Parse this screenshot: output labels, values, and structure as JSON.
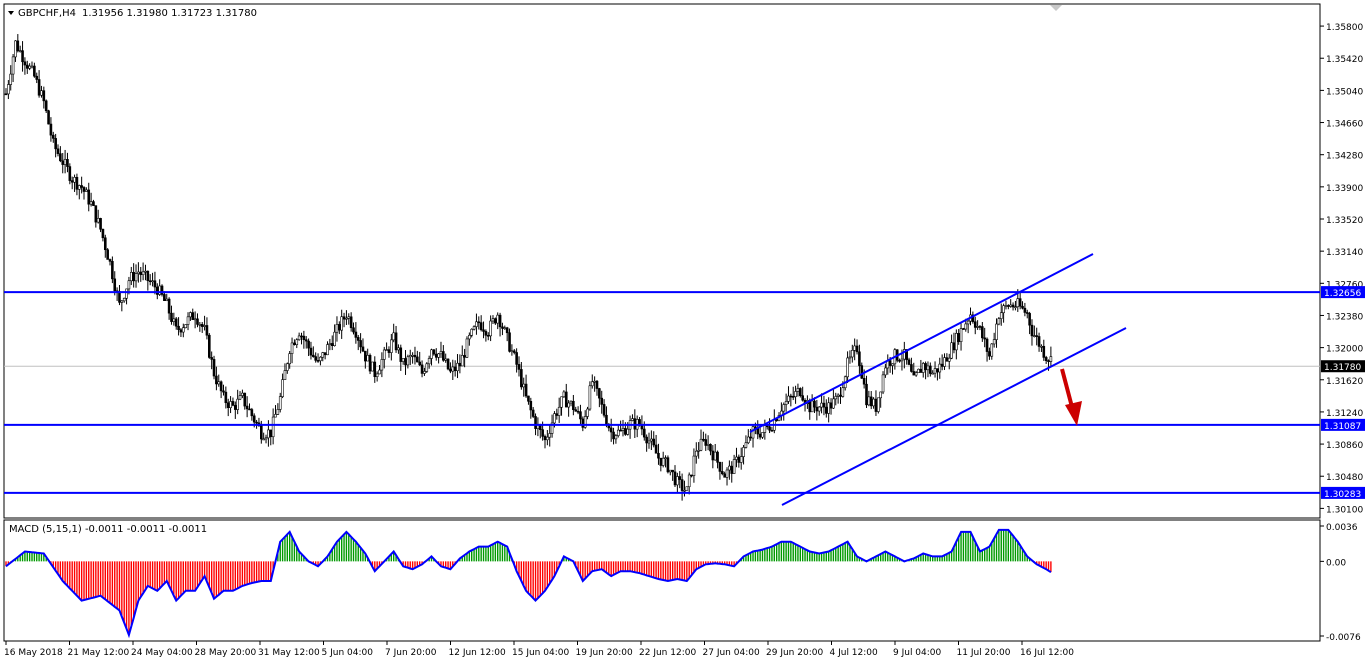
{
  "header": {
    "symbol": "GBPCHF,H4",
    "ohlc": "1.31956 1.31980 1.31723 1.31780",
    "menu_icon": "triangle-down-icon"
  },
  "macd_header": "MACD (5,15,1) -0.0011 -0.0011 -0.0011",
  "colors": {
    "candle": "#000000",
    "level_line": "#0000ff",
    "channel_line": "#0000ff",
    "arrow": "#cc0000",
    "macd_pos": "#009900",
    "macd_neg": "#ff0000",
    "macd_signal": "#0000ff",
    "price_line": "#c0c0c0",
    "label_bg": "#0000ff"
  },
  "chart_data": {
    "type": "candlestick",
    "price_axis": {
      "range": [
        1.3001,
        1.3599
      ],
      "ticks": [
        "1.35800",
        "1.35420",
        "1.35040",
        "1.34660",
        "1.34280",
        "1.33900",
        "1.33520",
        "1.33140",
        "1.32760",
        "1.32380",
        "1.32000",
        "1.31620",
        "1.31240",
        "1.30860",
        "1.30480",
        "1.30100"
      ]
    },
    "horizontal_levels": [
      {
        "value": 1.32656,
        "label": "1.32656"
      },
      {
        "value": 1.31087,
        "label": "1.31087"
      },
      {
        "value": 1.30283,
        "label": "1.30283"
      }
    ],
    "current_price": {
      "value": 1.3178,
      "label": "1.31780"
    },
    "time_labels": [
      "16 May 2018",
      "21 May 12:00",
      "24 May 04:00",
      "28 May 20:00",
      "31 May 12:00",
      "5 Jun 04:00",
      "7 Jun 20:00",
      "12 Jun 12:00",
      "15 Jun 04:00",
      "19 Jun 20:00",
      "22 Jun 12:00",
      "27 Jun 04:00",
      "29 Jun 20:00",
      "4 Jul 12:00",
      "9 Jul 04:00",
      "11 Jul 20:00",
      "16 Jul 12:00"
    ],
    "close_path": [
      [
        0,
        1.35
      ],
      [
        4,
        1.356
      ],
      [
        8,
        1.354
      ],
      [
        12,
        1.352
      ],
      [
        16,
        1.349
      ],
      [
        20,
        1.344
      ],
      [
        24,
        1.342
      ],
      [
        28,
        1.34
      ],
      [
        32,
        1.339
      ],
      [
        36,
        1.337
      ],
      [
        40,
        1.334
      ],
      [
        44,
        1.33
      ],
      [
        48,
        1.325
      ],
      [
        52,
        1.328
      ],
      [
        56,
        1.329
      ],
      [
        60,
        1.328
      ],
      [
        64,
        1.327
      ],
      [
        68,
        1.325
      ],
      [
        72,
        1.322
      ],
      [
        76,
        1.323
      ],
      [
        80,
        1.324
      ],
      [
        84,
        1.322
      ],
      [
        88,
        1.317
      ],
      [
        92,
        1.314
      ],
      [
        96,
        1.313
      ],
      [
        100,
        1.314
      ],
      [
        104,
        1.312
      ],
      [
        108,
        1.31
      ],
      [
        112,
        1.31
      ],
      [
        116,
        1.314
      ],
      [
        120,
        1.32
      ],
      [
        124,
        1.322
      ],
      [
        128,
        1.32
      ],
      [
        132,
        1.318
      ],
      [
        136,
        1.32
      ],
      [
        140,
        1.322
      ],
      [
        144,
        1.324
      ],
      [
        148,
        1.322
      ],
      [
        152,
        1.319
      ],
      [
        156,
        1.317
      ],
      [
        160,
        1.319
      ],
      [
        164,
        1.321
      ],
      [
        168,
        1.318
      ],
      [
        172,
        1.319
      ],
      [
        176,
        1.317
      ],
      [
        180,
        1.32
      ],
      [
        184,
        1.319
      ],
      [
        188,
        1.317
      ],
      [
        192,
        1.318
      ],
      [
        196,
        1.321
      ],
      [
        200,
        1.323
      ],
      [
        204,
        1.322
      ],
      [
        208,
        1.324
      ],
      [
        212,
        1.321
      ],
      [
        216,
        1.318
      ],
      [
        220,
        1.314
      ],
      [
        224,
        1.311
      ],
      [
        228,
        1.309
      ],
      [
        232,
        1.312
      ],
      [
        236,
        1.314
      ],
      [
        240,
        1.313
      ],
      [
        244,
        1.311
      ],
      [
        248,
        1.316
      ],
      [
        252,
        1.313
      ],
      [
        256,
        1.31
      ],
      [
        260,
        1.31
      ],
      [
        264,
        1.311
      ],
      [
        268,
        1.311
      ],
      [
        272,
        1.309
      ],
      [
        276,
        1.307
      ],
      [
        280,
        1.306
      ],
      [
        284,
        1.304
      ],
      [
        288,
        1.303
      ],
      [
        292,
        1.308
      ],
      [
        296,
        1.309
      ],
      [
        300,
        1.307
      ],
      [
        304,
        1.305
      ],
      [
        308,
        1.306
      ],
      [
        312,
        1.308
      ],
      [
        316,
        1.31
      ],
      [
        320,
        1.31
      ],
      [
        324,
        1.311
      ],
      [
        328,
        1.313
      ],
      [
        332,
        1.314
      ],
      [
        336,
        1.315
      ],
      [
        340,
        1.313
      ],
      [
        344,
        1.313
      ],
      [
        348,
        1.313
      ],
      [
        352,
        1.314
      ],
      [
        356,
        1.318
      ],
      [
        360,
        1.32
      ],
      [
        364,
        1.314
      ],
      [
        368,
        1.313
      ],
      [
        372,
        1.318
      ],
      [
        376,
        1.319
      ],
      [
        380,
        1.319
      ],
      [
        384,
        1.316
      ],
      [
        388,
        1.318
      ],
      [
        392,
        1.317
      ],
      [
        396,
        1.318
      ],
      [
        400,
        1.32
      ],
      [
        404,
        1.322
      ],
      [
        408,
        1.324
      ],
      [
        412,
        1.322
      ],
      [
        416,
        1.319
      ],
      [
        420,
        1.324
      ],
      [
        424,
        1.325
      ],
      [
        428,
        1.325
      ],
      [
        432,
        1.324
      ],
      [
        434,
        1.322
      ],
      [
        436,
        1.321
      ],
      [
        440,
        1.319
      ],
      [
        442,
        1.3186
      ]
    ],
    "macd": {
      "range": [
        -0.0076,
        0.0036
      ],
      "ticks": [
        "0.0036",
        "0.00",
        "-0.0076"
      ],
      "path": [
        [
          0,
          -0.0005
        ],
        [
          8,
          0.001
        ],
        [
          16,
          0.0008
        ],
        [
          24,
          -0.002
        ],
        [
          32,
          -0.004
        ],
        [
          40,
          -0.0035
        ],
        [
          48,
          -0.005
        ],
        [
          52,
          -0.0075
        ],
        [
          56,
          -0.004
        ],
        [
          60,
          -0.0025
        ],
        [
          64,
          -0.003
        ],
        [
          68,
          -0.002
        ],
        [
          72,
          -0.004
        ],
        [
          76,
          -0.003
        ],
        [
          80,
          -0.003
        ],
        [
          84,
          -0.0015
        ],
        [
          88,
          -0.0038
        ],
        [
          92,
          -0.003
        ],
        [
          96,
          -0.003
        ],
        [
          100,
          -0.0025
        ],
        [
          104,
          -0.0022
        ],
        [
          108,
          -0.002
        ],
        [
          112,
          -0.002
        ],
        [
          116,
          0.002
        ],
        [
          120,
          0.003
        ],
        [
          124,
          0.001
        ],
        [
          128,
          0.0
        ],
        [
          132,
          -0.0005
        ],
        [
          136,
          0.0005
        ],
        [
          140,
          0.002
        ],
        [
          144,
          0.003
        ],
        [
          148,
          0.002
        ],
        [
          152,
          0.0008
        ],
        [
          156,
          -0.001
        ],
        [
          160,
          0.0
        ],
        [
          164,
          0.001
        ],
        [
          168,
          -0.0005
        ],
        [
          172,
          -0.0008
        ],
        [
          176,
          -0.0003
        ],
        [
          180,
          0.0005
        ],
        [
          184,
          -0.0005
        ],
        [
          188,
          -0.0008
        ],
        [
          192,
          0.0003
        ],
        [
          196,
          0.001
        ],
        [
          200,
          0.0015
        ],
        [
          204,
          0.0015
        ],
        [
          208,
          0.002
        ],
        [
          212,
          0.0015
        ],
        [
          216,
          -0.001
        ],
        [
          220,
          -0.003
        ],
        [
          224,
          -0.004
        ],
        [
          228,
          -0.003
        ],
        [
          232,
          -0.0015
        ],
        [
          236,
          0.0005
        ],
        [
          240,
          0.0
        ],
        [
          244,
          -0.002
        ],
        [
          248,
          -0.001
        ],
        [
          252,
          -0.0008
        ],
        [
          256,
          -0.0015
        ],
        [
          260,
          -0.001
        ],
        [
          264,
          -0.001
        ],
        [
          268,
          -0.0012
        ],
        [
          272,
          -0.0015
        ],
        [
          276,
          -0.0018
        ],
        [
          280,
          -0.002
        ],
        [
          284,
          -0.0018
        ],
        [
          288,
          -0.002
        ],
        [
          292,
          -0.0008
        ],
        [
          296,
          -0.0003
        ],
        [
          300,
          -0.0002
        ],
        [
          304,
          -0.0003
        ],
        [
          308,
          -0.0005
        ],
        [
          312,
          0.0005
        ],
        [
          316,
          0.001
        ],
        [
          320,
          0.0012
        ],
        [
          324,
          0.0015
        ],
        [
          328,
          0.002
        ],
        [
          332,
          0.002
        ],
        [
          336,
          0.0015
        ],
        [
          340,
          0.001
        ],
        [
          344,
          0.0008
        ],
        [
          348,
          0.001
        ],
        [
          352,
          0.0015
        ],
        [
          356,
          0.002
        ],
        [
          360,
          0.0005
        ],
        [
          364,
          0.0
        ],
        [
          368,
          0.0005
        ],
        [
          372,
          0.001
        ],
        [
          376,
          0.0005
        ],
        [
          380,
          0.0
        ],
        [
          384,
          0.0003
        ],
        [
          388,
          0.0008
        ],
        [
          392,
          0.0005
        ],
        [
          396,
          0.0005
        ],
        [
          400,
          0.001
        ],
        [
          404,
          0.003
        ],
        [
          408,
          0.003
        ],
        [
          412,
          0.001
        ],
        [
          416,
          0.0015
        ],
        [
          420,
          0.0032
        ],
        [
          424,
          0.0032
        ],
        [
          428,
          0.002
        ],
        [
          432,
          0.0005
        ],
        [
          436,
          -0.0003
        ],
        [
          440,
          -0.0008
        ],
        [
          442,
          -0.0011
        ]
      ]
    }
  }
}
